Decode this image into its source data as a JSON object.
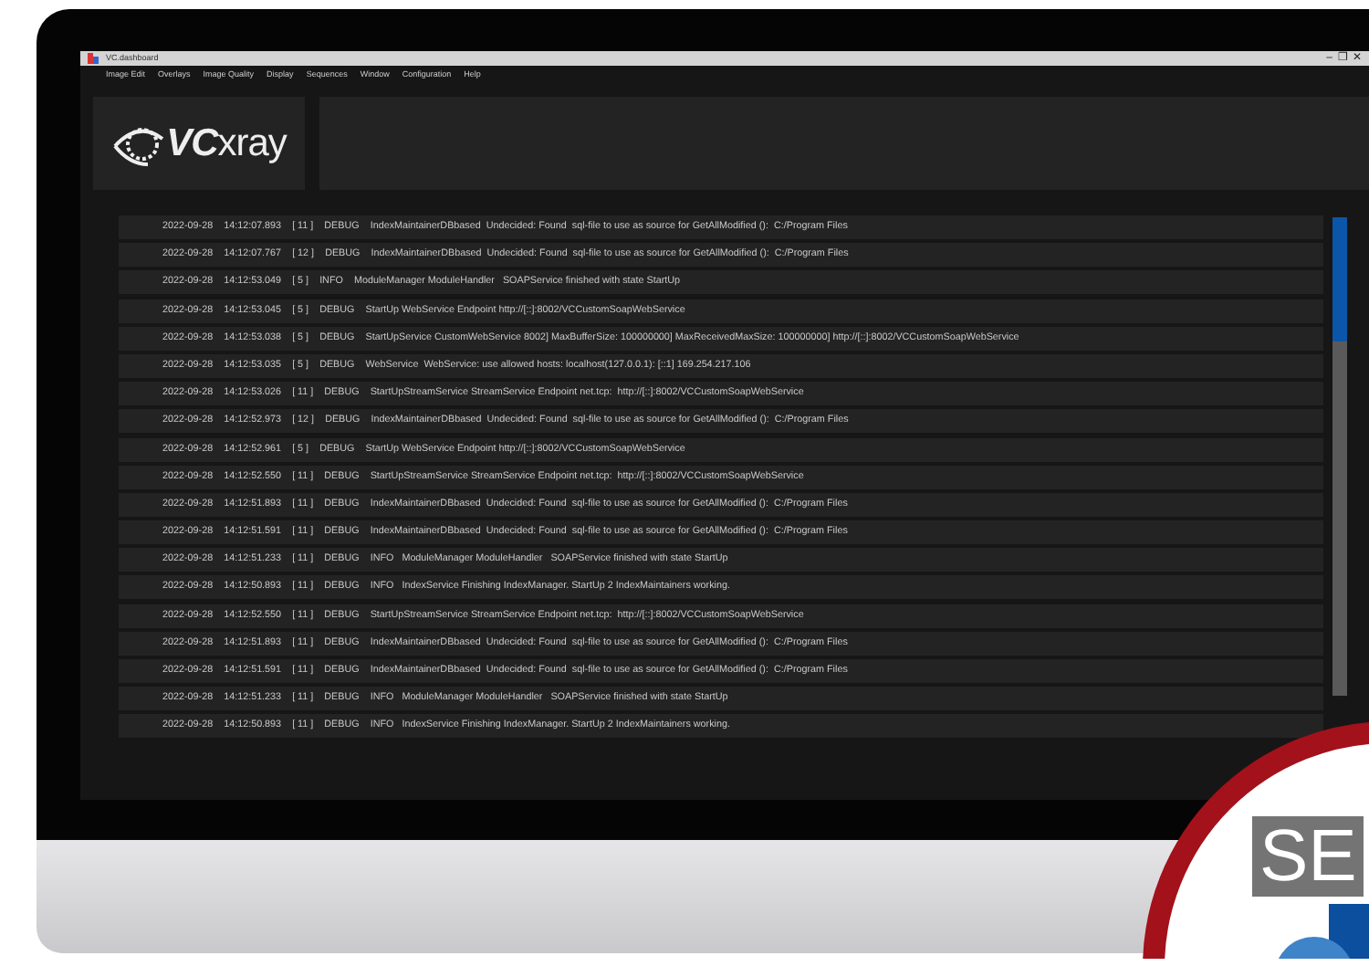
{
  "window": {
    "title": "VC.dashboard",
    "controls": [
      "–",
      "❐",
      "✕"
    ]
  },
  "menu": [
    "Image Edit",
    "Overlays",
    "Image Quality",
    "Display",
    "Sequences",
    "Window",
    "Configuration",
    "Help"
  ],
  "logo": {
    "text": "**VC**xray"
  },
  "log": [
    {
      "date": "2022-09-28",
      "time": "14:12:07.893",
      "thread": "[ 11 ]",
      "level": "DEBUG",
      "message": "IndexMaintainerDBbased  Undecided: Found  sql-file to use as source for GetAllModified ():  C:/Program Files"
    },
    {
      "date": "2022-09-28",
      "time": "14:12:07.767",
      "thread": "[ 12 ]",
      "level": "DEBUG",
      "message": "IndexMaintainerDBbased  Undecided: Found  sql-file to use as source for GetAllModified ():  C:/Program Files"
    },
    {
      "date": "2022-09-28",
      "time": "14:12:53.049",
      "thread": "[ 5 ]",
      "level": "INFO",
      "message": "ModuleManager ModuleHandler   SOAPService finished with state StartUp"
    },
    {
      "date": "2022-09-28",
      "time": "14:12:53.045",
      "thread": "[ 5 ]",
      "level": "DEBUG",
      "message": "StartUp WebService Endpoint http://[::]:8002/VCCustomSoapWebService"
    },
    {
      "date": "2022-09-28",
      "time": "14:12:53.038",
      "thread": "[ 5 ]",
      "level": "DEBUG",
      "message": "StartUpService CustomWebService 8002] MaxBufferSize: 100000000] MaxReceivedMaxSize: 100000000] http://[::]:8002/VCCustomSoapWebService"
    },
    {
      "date": "2022-09-28",
      "time": "14:12:53.035",
      "thread": "[ 5 ]",
      "level": "DEBUG",
      "message": "WebService  WebService: use allowed hosts: localhost(127.0.0.1): [::1] 169.254.217.106"
    },
    {
      "date": "2022-09-28",
      "time": "14:12:53.026",
      "thread": "[ 11 ]",
      "level": "DEBUG",
      "message": "StartUpStreamService StreamService Endpoint net.tcp:  http://[::]:8002/VCCustomSoapWebService"
    },
    {
      "date": "2022-09-28",
      "time": "14:12:52.973",
      "thread": "[ 12 ]",
      "level": "DEBUG",
      "message": "IndexMaintainerDBbased  Undecided: Found  sql-file to use as source for GetAllModified ():  C:/Program Files"
    },
    {
      "date": "2022-09-28",
      "time": "14:12:52.961",
      "thread": "[ 5 ]",
      "level": "DEBUG",
      "message": "StartUp WebService Endpoint http://[::]:8002/VCCustomSoapWebService"
    },
    {
      "date": "2022-09-28",
      "time": "14:12:52.550",
      "thread": "[ 11 ]",
      "level": "DEBUG",
      "message": "StartUpStreamService StreamService Endpoint net.tcp:  http://[::]:8002/VCCustomSoapWebService"
    },
    {
      "date": "2022-09-28",
      "time": "14:12:51.893",
      "thread": "[ 11 ]",
      "level": "DEBUG",
      "message": "IndexMaintainerDBbased  Undecided: Found  sql-file to use as source for GetAllModified ():  C:/Program Files"
    },
    {
      "date": "2022-09-28",
      "time": "14:12:51.591",
      "thread": "[ 11 ]",
      "level": "DEBUG",
      "message": "IndexMaintainerDBbased  Undecided: Found  sql-file to use as source for GetAllModified ():  C:/Program Files"
    },
    {
      "date": "2022-09-28",
      "time": "14:12:51.233",
      "thread": "[ 11 ]",
      "level": "DEBUG",
      "message": "INFO   ModuleManager ModuleHandler   SOAPService finished with state StartUp"
    },
    {
      "date": "2022-09-28",
      "time": "14:12:50.893",
      "thread": "[ 11 ]",
      "level": "DEBUG",
      "message": "INFO   IndexService Finishing IndexManager. StartUp 2 IndexMaintainers working."
    },
    {
      "date": "2022-09-28",
      "time": "14:12:52.550",
      "thread": "[ 11 ]",
      "level": "DEBUG",
      "message": "StartUpStreamService StreamService Endpoint net.tcp:  http://[::]:8002/VCCustomSoapWebService"
    },
    {
      "date": "2022-09-28",
      "time": "14:12:51.893",
      "thread": "[ 11 ]",
      "level": "DEBUG",
      "message": "IndexMaintainerDBbased  Undecided: Found  sql-file to use as source for GetAllModified ():  C:/Program Files"
    },
    {
      "date": "2022-09-28",
      "time": "14:12:51.591",
      "thread": "[ 11 ]",
      "level": "DEBUG",
      "message": "IndexMaintainerDBbased  Undecided: Found  sql-file to use as source for GetAllModified ():  C:/Program Files"
    },
    {
      "date": "2022-09-28",
      "time": "14:12:51.233",
      "thread": "[ 11 ]",
      "level": "DEBUG",
      "message": "INFO   ModuleManager ModuleHandler   SOAPService finished with state StartUp"
    },
    {
      "date": "2022-09-28",
      "time": "14:12:50.893",
      "thread": "[ 11 ]",
      "level": "DEBUG",
      "message": "INFO   IndexService Finishing IndexManager. StartUp 2 IndexMaintainers working."
    }
  ],
  "seal": {
    "text": "SE"
  }
}
